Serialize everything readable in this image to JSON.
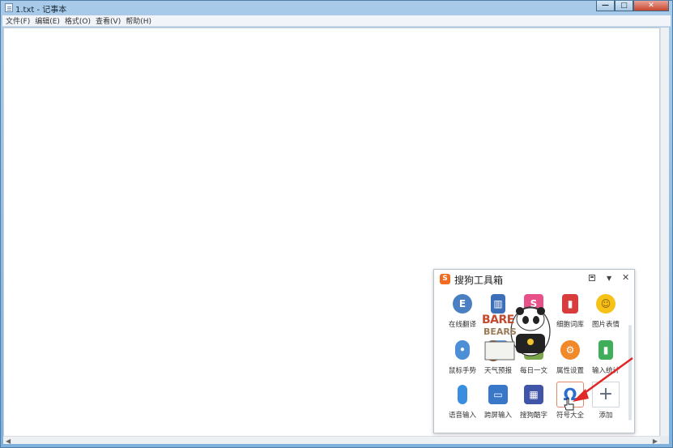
{
  "window": {
    "title": "1.txt - 记事本",
    "buttons": {
      "minimize": "—",
      "maximize": "□",
      "close": "✕"
    }
  },
  "menubar": {
    "items": [
      "文件(F)",
      "编辑(E)",
      "格式(O)",
      "查看(V)",
      "帮助(H)"
    ]
  },
  "toolbox": {
    "logo": "S",
    "title": "搜狗工具箱",
    "close": "✕",
    "down": "▼",
    "tools": [
      {
        "label": "在线翻译",
        "icon": "translate-icon",
        "color": "#4a7fc1"
      },
      {
        "label": "",
        "icon": "book-icon",
        "color": "#3d6fb8"
      },
      {
        "label": "",
        "icon": "skin-icon",
        "color": "#e8508a"
      },
      {
        "label": "细胞词库",
        "icon": "dictionary-icon",
        "color": "#d83c3c"
      },
      {
        "label": "图片表情",
        "icon": "emoji-icon",
        "color": "#f6c218"
      },
      {
        "label": "鼠标手势",
        "icon": "mouse-icon",
        "color": "#4c8fd6"
      },
      {
        "label": "天气预报",
        "icon": "weather-icon",
        "color": "#6aa0d8"
      },
      {
        "label": "每日一文",
        "icon": "article-icon",
        "color": "#7aa74a"
      },
      {
        "label": "属性设置",
        "icon": "settings-icon",
        "color": "#f08a2a"
      },
      {
        "label": "输入统计",
        "icon": "stats-icon",
        "color": "#3fae5a"
      },
      {
        "label": "语音输入",
        "icon": "microphone-icon",
        "color": "#3a8ee0"
      },
      {
        "label": "跨屏输入",
        "icon": "cross-screen-icon",
        "color": "#3977c9"
      },
      {
        "label": "搜狗酷字",
        "icon": "cool-text-icon",
        "color": "#4054a8"
      },
      {
        "label": "符号大全",
        "icon": "omega-icon",
        "color": "#2a6fcf"
      },
      {
        "label": "添加",
        "icon": "plus-icon",
        "color": "#5a6b7d"
      }
    ],
    "mascot": {
      "text1": "BARE",
      "text2": "BEARS"
    }
  }
}
